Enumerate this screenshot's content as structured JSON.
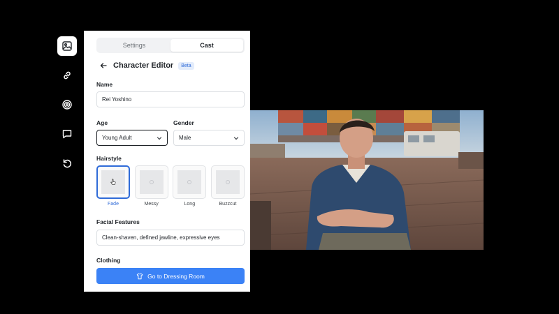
{
  "rail": {
    "items": [
      {
        "icon": "image-icon",
        "active": true
      },
      {
        "icon": "link-icon",
        "active": false
      },
      {
        "icon": "target-icon",
        "active": false
      },
      {
        "icon": "chat-icon",
        "active": false
      },
      {
        "icon": "undo-icon",
        "active": false
      }
    ]
  },
  "tabs": [
    {
      "label": "Settings",
      "active": false
    },
    {
      "label": "Cast",
      "active": true
    }
  ],
  "header": {
    "title": "Character Editor",
    "badge": "Beta"
  },
  "form": {
    "name_label": "Name",
    "name_value": "Rei Yoshino",
    "age_label": "Age",
    "age_value": "Young Adult",
    "gender_label": "Gender",
    "gender_value": "Male",
    "hairstyle_label": "Hairstyle",
    "hairstyles": [
      {
        "label": "Fade",
        "selected": true
      },
      {
        "label": "Messy",
        "selected": false
      },
      {
        "label": "Long",
        "selected": false
      },
      {
        "label": "Buzzcut",
        "selected": false
      }
    ],
    "facial_label": "Facial Features",
    "facial_value": "Clean-shaven, defined jawline, expressive eyes",
    "clothing_label": "Clothing",
    "cta_label": "Go to Dressing Room"
  },
  "colors": {
    "accent": "#3b82f6",
    "selected": "#2f6bd8",
    "background": "#000000"
  }
}
